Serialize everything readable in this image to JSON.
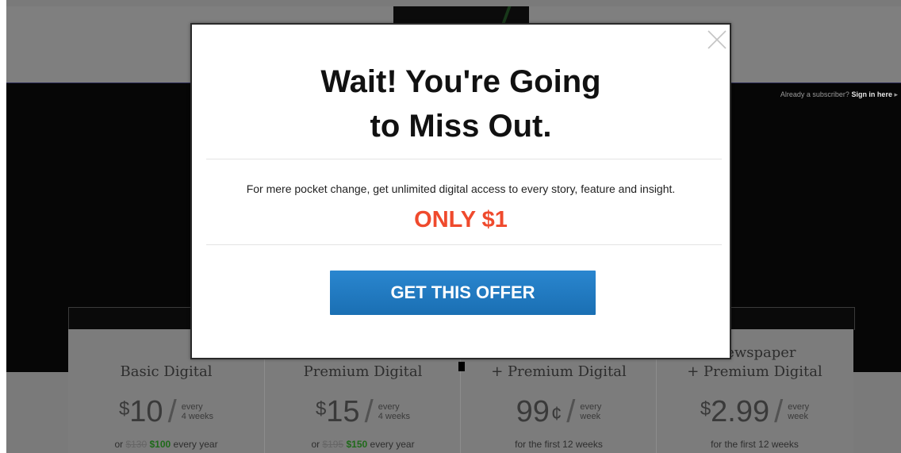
{
  "background": {
    "signin_prompt": "Already a subscriber?",
    "signin_link": "Sign in here",
    "signin_arrow": "▸"
  },
  "plans": [
    {
      "title_lines": [
        "Basic Digital"
      ],
      "currency": "$",
      "amount": "10",
      "cents": "",
      "period": [
        "every",
        "4 weeks"
      ],
      "sub_prefix": "or ",
      "sub_strike": "$130",
      "sub_sale": "$100",
      "sub_suffix": " every year"
    },
    {
      "title_lines": [
        "Premium Digital"
      ],
      "currency": "$",
      "amount": "15",
      "cents": "",
      "period": [
        "every",
        "4 weeks"
      ],
      "sub_prefix": "or ",
      "sub_strike": "$195",
      "sub_sale": "$150",
      "sub_suffix": " every year"
    },
    {
      "title_lines": [
        "+ Premium Digital"
      ],
      "currency": "",
      "amount": "99",
      "cents": "¢",
      "period": [
        "every",
        "week"
      ],
      "sub_text": "for the first 12 weeks"
    },
    {
      "title_lines": [
        "Newspaper",
        "+ Premium Digital"
      ],
      "currency": "$",
      "amount": "2.99",
      "cents": "",
      "period": [
        "every",
        "week"
      ],
      "sub_text": "for the first 12 weeks"
    }
  ],
  "modal": {
    "headline_line1": "Wait! You're Going",
    "headline_line2": "to Miss Out.",
    "tagline": "For mere pocket change, get unlimited digital access to every story, feature and insight.",
    "price": "ONLY $1",
    "cta_label": "GET THIS OFFER",
    "close_icon": "close-icon",
    "colors": {
      "price": "#ef4a2d",
      "cta": "#1f78c1"
    }
  }
}
